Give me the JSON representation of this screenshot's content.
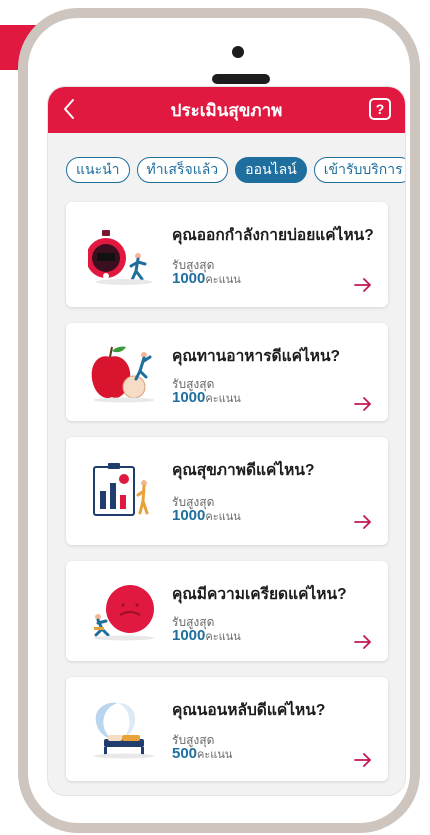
{
  "header": {
    "title": "ประเมินสุขภาพ",
    "help_label": "?"
  },
  "tabs": [
    {
      "label": "แนะนำ",
      "active": false
    },
    {
      "label": "ทำเสร็จแล้ว",
      "active": false
    },
    {
      "label": "ออนไลน์",
      "active": true
    },
    {
      "label": "เข้ารับบริการ",
      "active": false
    }
  ],
  "assessments": [
    {
      "title": "คุณออกกำลังกายบ่อยแค่ไหน?",
      "reward_label": "รับสูงสุด",
      "points": "1000",
      "points_unit": "คะแนน",
      "icon": "stopwatch-runner-icon"
    },
    {
      "title": "คุณทานอาหารดีแค่ไหน?",
      "reward_label": "รับสูงสุด",
      "points": "1000",
      "points_unit": "คะแนน",
      "icon": "apple-nutrition-icon"
    },
    {
      "title": "คุณสุขภาพดีแค่ไหน?",
      "reward_label": "รับสูงสุด",
      "points": "1000",
      "points_unit": "คะแนน",
      "icon": "health-chart-icon"
    },
    {
      "title": "คุณมีความเครียดแค่ไหน?",
      "reward_label": "รับสูงสุด",
      "points": "1000",
      "points_unit": "คะแนน",
      "icon": "stress-ball-icon"
    },
    {
      "title": "คุณนอนหลับดีแค่ไหน?",
      "reward_label": "รับสูงสุด",
      "points": "500",
      "points_unit": "คะแนน",
      "icon": "sleep-moon-icon"
    }
  ],
  "colors": {
    "brand_red": "#e1183f",
    "accent_blue": "#1f6f9e",
    "arrow_magenta": "#c0185a",
    "frame": "#cdc5be"
  }
}
